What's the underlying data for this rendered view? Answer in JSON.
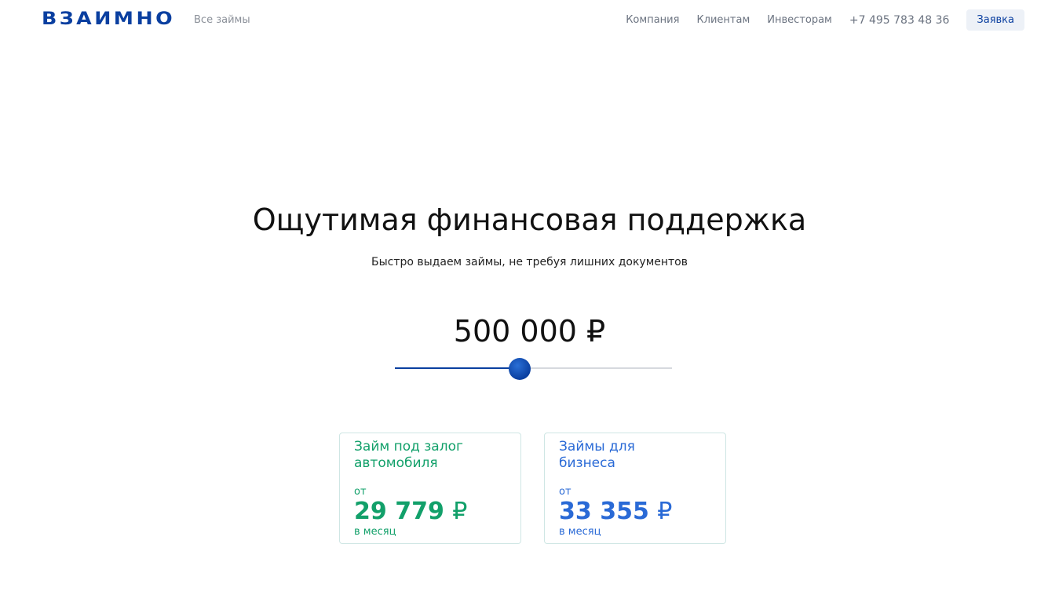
{
  "header": {
    "logo_text": "ВЗАИМНО",
    "all_loans_label": "Все займы",
    "nav": [
      {
        "label": "Компания"
      },
      {
        "label": "Клиентам"
      },
      {
        "label": "Инвесторам"
      }
    ],
    "phone": "+7 495 783 48 36",
    "apply_label": "Заявка"
  },
  "hero": {
    "title": "Ощутимая финансовая поддержка",
    "subtitle": "Быстро выдаем займы, не требуя лишних документов",
    "amount": "500 000 ₽",
    "slider_fraction": 0.45
  },
  "cards": [
    {
      "title_line1": "Займ под залог",
      "title_line2": "автомобиля",
      "from": "от",
      "price": "29 779",
      "currency": "₽",
      "per": "в месяц",
      "color": "#12a06a"
    },
    {
      "title_line1": "Займы для",
      "title_line2": "бизнеса",
      "from": "от",
      "price": "33 355",
      "currency": "₽",
      "per": "в месяц",
      "color": "#2a6ad6"
    }
  ],
  "colors": {
    "brand": "#0a3fa0",
    "accent_green": "#12a06a",
    "accent_blue": "#2a6ad6"
  }
}
